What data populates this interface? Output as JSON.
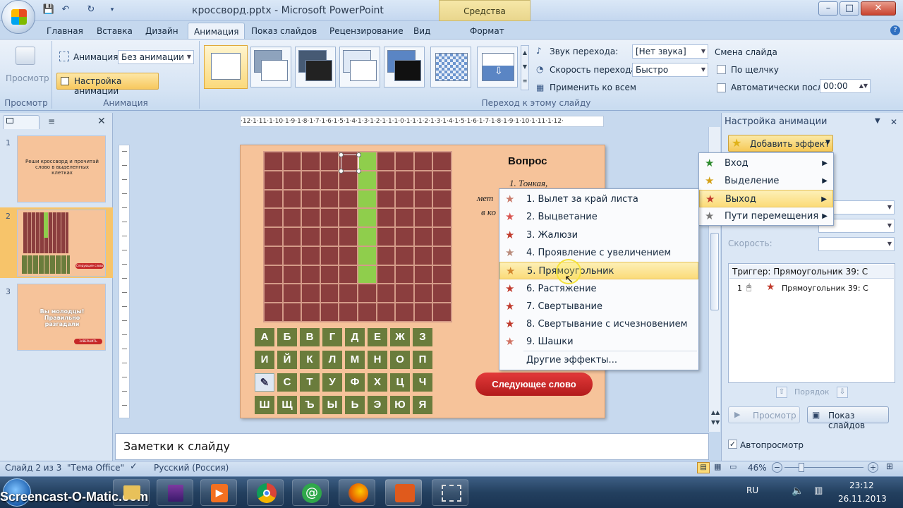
{
  "window": {
    "title": "кроссворд.pptx - Microsoft PowerPoint",
    "contextual_tab_title": "Средства рисования",
    "minimize": "–",
    "maximize": "□",
    "close": "✕"
  },
  "tabs": [
    "Главная",
    "Вставка",
    "Дизайн",
    "Анимация",
    "Показ слайдов",
    "Рецензирование",
    "Вид",
    "Формат"
  ],
  "ribbon": {
    "preview_label": "Просмотр",
    "preview_group": "Просмотр",
    "animation_label": "Анимация:",
    "animation_value": "Без анимации",
    "custom_animation_button": "Настройка анимации",
    "animation_group": "Анимация",
    "sound_label": "Звук перехода:",
    "sound_value": "[Нет звука]",
    "speed_label": "Скорость перехода:",
    "speed_value": "Быстро",
    "apply_all": "Применить ко всем",
    "transition_group": "Переход к этому слайду",
    "advance_title": "Смена слайда",
    "on_click": "По щелчку",
    "auto_after": "Автоматически после:",
    "auto_time": "00:00"
  },
  "ruler": {
    "h_ticks": "·12·1·11·1·10·1·9·1·8·1·7·1·6·1·5·1·4·1·3·1·2·1·1·1·0·1·1·1·2·1·3·1·4·1·5·1·6·1·7·1·8·1·9·1·10·1·11·1·12·"
  },
  "slides_panel": {
    "slides": [
      {
        "num": "1",
        "text": "Реши кроссворд и прочитай слово в выделенных клетках"
      },
      {
        "num": "2",
        "text": ""
      },
      {
        "num": "3",
        "text": "Вы молодцы! Правильно разгадали"
      }
    ],
    "thumb2_button": "Следующее слово",
    "thumb3_button": "ЗАВЕРШИТЬ"
  },
  "slide": {
    "question_title": "Вопрос",
    "question_line1": "1. Тонкая,",
    "question_line2": "мет",
    "question_line3": "в ко",
    "letters": [
      "А",
      "Б",
      "В",
      "Г",
      "Д",
      "Е",
      "Ж",
      "З",
      "И",
      "Й",
      "К",
      "Л",
      "М",
      "Н",
      "О",
      "П",
      "",
      "С",
      "Т",
      "У",
      "Ф",
      "Х",
      "Ц",
      "Ч",
      "Ш",
      "Щ",
      "Ъ",
      "Ы",
      "Ь",
      "Э",
      "Ю",
      "Я"
    ],
    "next_button": "Следующее слово"
  },
  "notes_placeholder": "Заметки к слайду",
  "taskpane": {
    "title": "Настройка анимации",
    "add_effect": "Добавить эффект",
    "speed_label": "Скорость:",
    "trigger": "Триггер: Прямоугольник 39: С",
    "list_item_num": "1",
    "list_item": "Прямоугольник 39: С",
    "order_label": "Порядок",
    "preview_button": "Просмотр",
    "slideshow_button": "Показ слайдов",
    "autopreview": "Автопросмотр"
  },
  "menu_effects": [
    {
      "label": "Вход",
      "highlighted": false,
      "color": "#2e8b2e"
    },
    {
      "label": "Выделение",
      "highlighted": false,
      "color": "#d4a017"
    },
    {
      "label": "Выход",
      "highlighted": true,
      "color": "#c0392b"
    },
    {
      "label": "Пути перемещения",
      "highlighted": false,
      "color": "#777777"
    }
  ],
  "menu_exit": [
    "1. Вылет за край листа",
    "2. Выцветание",
    "3. Жалюзи",
    "4. Проявление с увеличением",
    "5. Прямоугольник",
    "6. Растяжение",
    "7. Свертывание",
    "8. Свертывание с исчезновением",
    "9. Шашки",
    "Другие эффекты..."
  ],
  "menu_exit_highlight_index": 4,
  "statusbar": {
    "slide_info": "Слайд 2 из 3",
    "theme": "\"Тема Office\"",
    "language": "Русский (Россия)",
    "zoom": "46%"
  },
  "taskbar": {
    "watermark": "Screencast-O-Matic.com",
    "lang": "RU",
    "time": "23:12",
    "date": "26.11.2013"
  }
}
